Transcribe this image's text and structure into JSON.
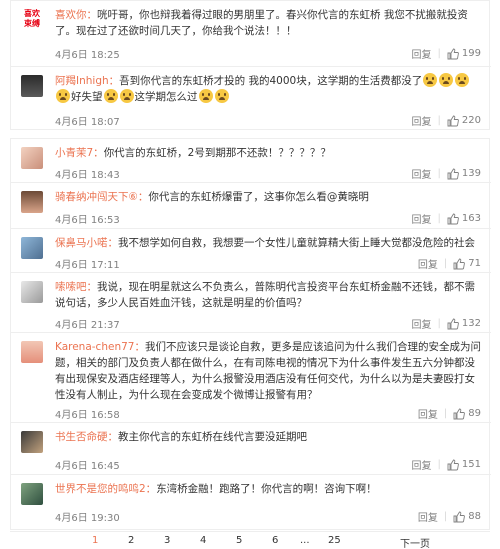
{
  "icons": {
    "like": "thumbs-up-icon",
    "emoji": "crying-face-icon"
  },
  "colors": {
    "username": "#eb7350",
    "meta": "#808080"
  },
  "section1": [
    {
      "avatar_text": "喜欢束缚",
      "username": "喜欢你：",
      "text1": "咣吁哥，你也辩我着得过眼的男朋里了。春兴你代言的东虹桥 我您不扰搬就投资了。现在过了还欲时间几天了，你给我个说法！！！",
      "date": "4月6日 18:25",
      "reply": "回复",
      "likes": "199"
    },
    {
      "avatar_text": "",
      "username": "阿羯Inhigh：",
      "text1": "吾到你代言的东虹桥才投的 我的4000块，这学期的生活费都没了",
      "text2": "好失望",
      "text3": "这学期怎么过",
      "date": "4月6日 18:07",
      "reply": "回复",
      "likes": "220"
    }
  ],
  "section2": [
    {
      "username": "小青茉7：",
      "text1": "你代言的东虹桥，2号到期那不还款！？？？？？",
      "date": "4月6日 18:43",
      "reply": "回复",
      "likes": "139"
    },
    {
      "username": "骑春纳冲闯天下⑥：",
      "text1": "你代言的东虹桥爆雷了，这事你怎么看@黄晓明",
      "date": "4月6日 16:53",
      "reply": "回复",
      "likes": "163"
    },
    {
      "username": "保鼻马小喏：",
      "text1": "我不想学如何自救，我想要一个女性儿童就算精大街上睡大觉都没危险的社会",
      "date": "4月6日 17:11",
      "reply": "回复",
      "likes": "71"
    },
    {
      "username": "嗦嗦吧：",
      "text1": "我说，现在明星就这么不负责么，普陈明代言投资平台东虹桥金融不还钱，都不需说句话，多少人民百姓血汗钱，这就是明星的价值吗？",
      "date": "4月6日 21:37",
      "reply": "回复",
      "likes": "132"
    },
    {
      "username": "Karena-chen77：",
      "text1": "我们不应该只是谈论自救，更多是应该追问为什么我们合理的安全成为问题，相关的部门及负责人都在做什么，在有司陈电视的情况下为什么事件发生五六分钟都没有出现保安及酒店经理等人，为什么报警没用酒店没有任何交代，为什么以为是夫妻殴打女性没有人制止，为什么现在会变成发个微博让报警有用？",
      "date": "4月6日 16:58",
      "reply": "回复",
      "likes": "89"
    },
    {
      "username": "书生否命硬：",
      "text1": "教主你代言的东虹桥在线代言要没延期吧",
      "date": "4月6日 16:45",
      "reply": "回复",
      "likes": "151"
    },
    {
      "username": "世界不是您的鸣鸣2：",
      "text1": "东湾桥金融！跑路了！你代言的啊！咨询下啊！",
      "date": "4月6日 19:30",
      "reply": "回复",
      "likes": "88"
    }
  ],
  "pager": {
    "first": "1",
    "pages": [
      "2",
      "3",
      "4",
      "5",
      "6"
    ],
    "ellipsis": "...",
    "last_page": "25",
    "next": "下一页"
  }
}
